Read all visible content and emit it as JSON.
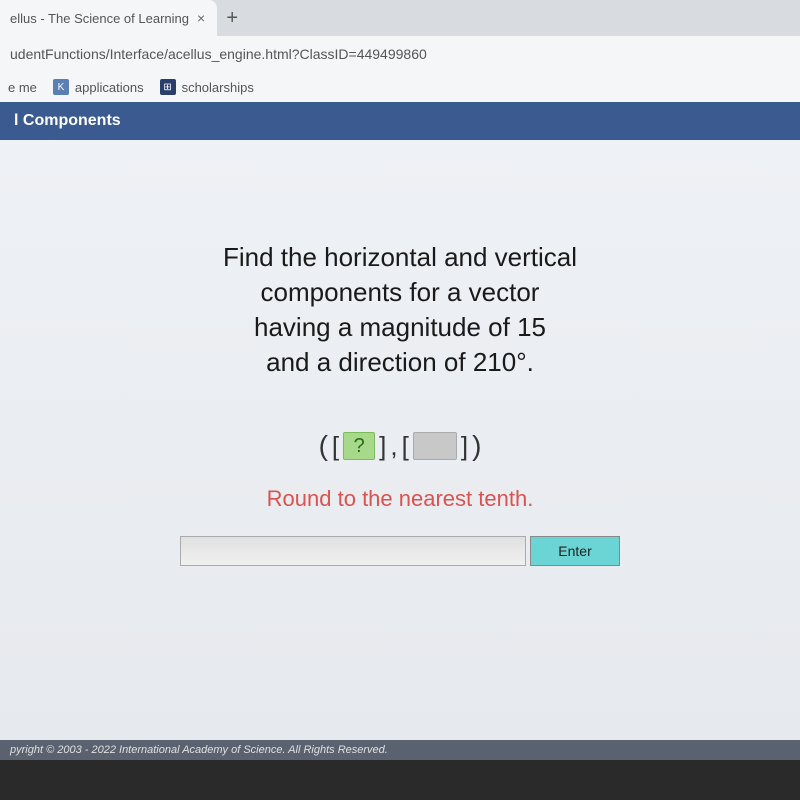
{
  "tab": {
    "title": "ellus - The Science of Learning",
    "close_label": "×"
  },
  "new_tab_label": "+",
  "url": "udentFunctions/Interface/acellus_engine.html?ClassID=449499860",
  "bookmarks": [
    {
      "label": "e me",
      "icon": ""
    },
    {
      "label": "applications",
      "icon": "K"
    },
    {
      "label": "scholarships",
      "icon": "⊞"
    }
  ],
  "page_header": "l Components",
  "problem": {
    "line1": "Find the horizontal and vertical",
    "line2": "components for a vector",
    "line3": "having a magnitude of 15",
    "line4": "and a direction of 210°."
  },
  "answer_format": {
    "open_paren": "(",
    "open_brk1": "[",
    "question": "?",
    "close_brk1": "]",
    "comma": ",",
    "open_brk2": "[",
    "blank": " ",
    "close_brk2": "]",
    "close_paren": ")"
  },
  "round_instruction": "Round to the nearest tenth.",
  "input": {
    "answer_value": "",
    "enter_label": "Enter"
  },
  "footer": "pyright © 2003 - 2022 International Academy of Science. All Rights Reserved."
}
